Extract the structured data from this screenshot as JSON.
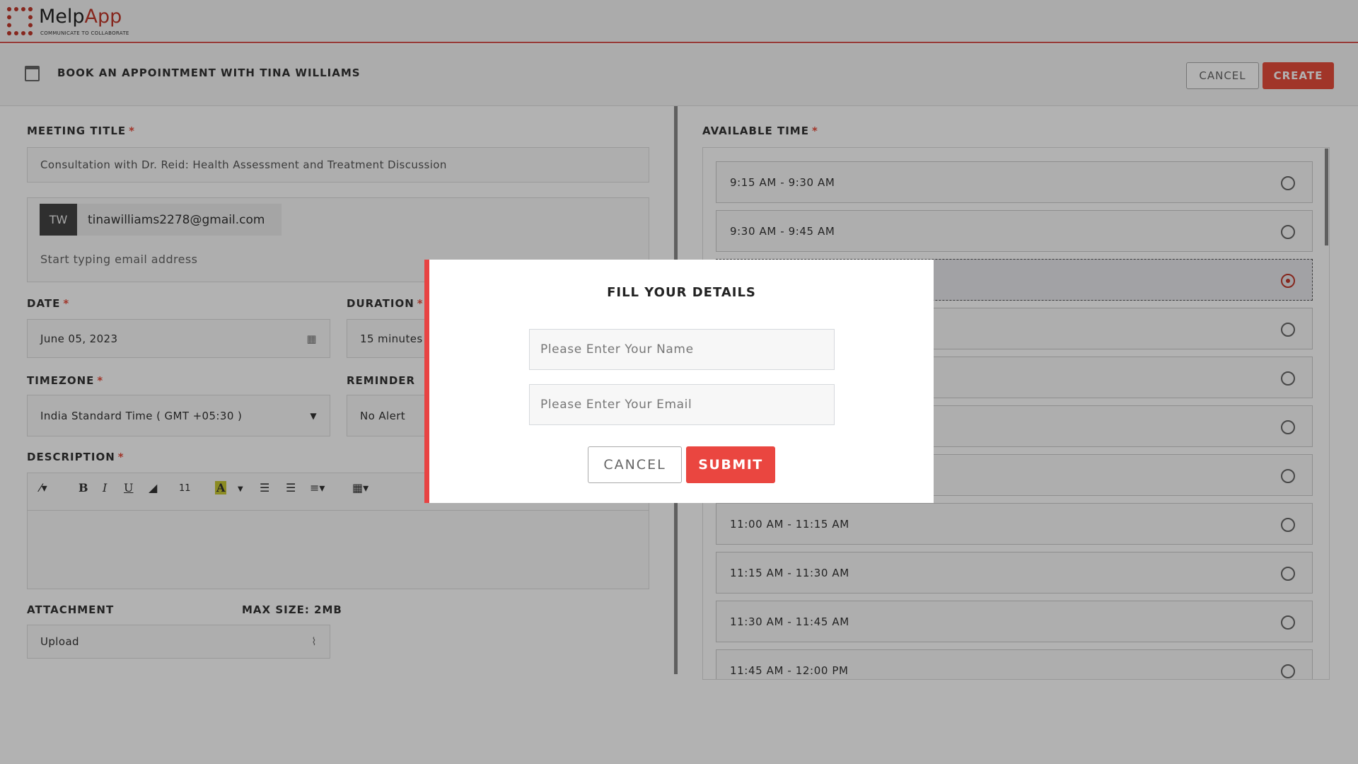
{
  "app": {
    "name_part1": "Melp",
    "name_part2": "App",
    "tagline": "COMMUNICATE TO COLLABORATE",
    "accent": "#e74c3c"
  },
  "page": {
    "title": "BOOK AN APPOINTMENT WITH TINA WILLIAMS",
    "cancel": "CANCEL",
    "create": "CREATE"
  },
  "form": {
    "meeting_title_label": "MEETING TITLE",
    "meeting_title_value": "Consultation with Dr. Reid: Health Assessment and Treatment Discussion",
    "required_mark": "*",
    "attendee": {
      "initials": "TW",
      "email": "tinawilliams2278@gmail.com"
    },
    "email_placeholder": "Start typing email address",
    "date_label": "DATE",
    "date_value": "June 05, 2023",
    "duration_label": "DURATION",
    "duration_value": "15 minutes",
    "timezone_label": "TIMEZONE",
    "timezone_value": "India Standard Time ( GMT +05:30 )",
    "reminder_label": "REMINDER",
    "reminder_value": "No Alert",
    "description_label": "DESCRIPTION",
    "toolbar": {
      "bold": "B",
      "italic": "I",
      "underline": "U",
      "font_size": "11",
      "color": "A"
    },
    "attachment_label": "ATTACHMENT",
    "max_size": "MAX SIZE: 2MB",
    "upload": "Upload"
  },
  "available": {
    "label": "AVAILABLE TIME",
    "selected_index": 2,
    "slots": [
      "9:15 AM - 9:30 AM",
      "9:30 AM - 9:45 AM",
      "",
      "",
      "",
      "",
      "",
      "11:00 AM - 11:15 AM",
      "11:15 AM - 11:30 AM",
      "11:30 AM - 11:45 AM",
      "11:45 AM - 12:00 PM"
    ]
  },
  "modal": {
    "title": "FILL YOUR DETAILS",
    "name_placeholder": "Please Enter Your Name",
    "email_placeholder": "Please Enter Your Email",
    "cancel": "CANCEL",
    "submit": "SUBMIT"
  }
}
